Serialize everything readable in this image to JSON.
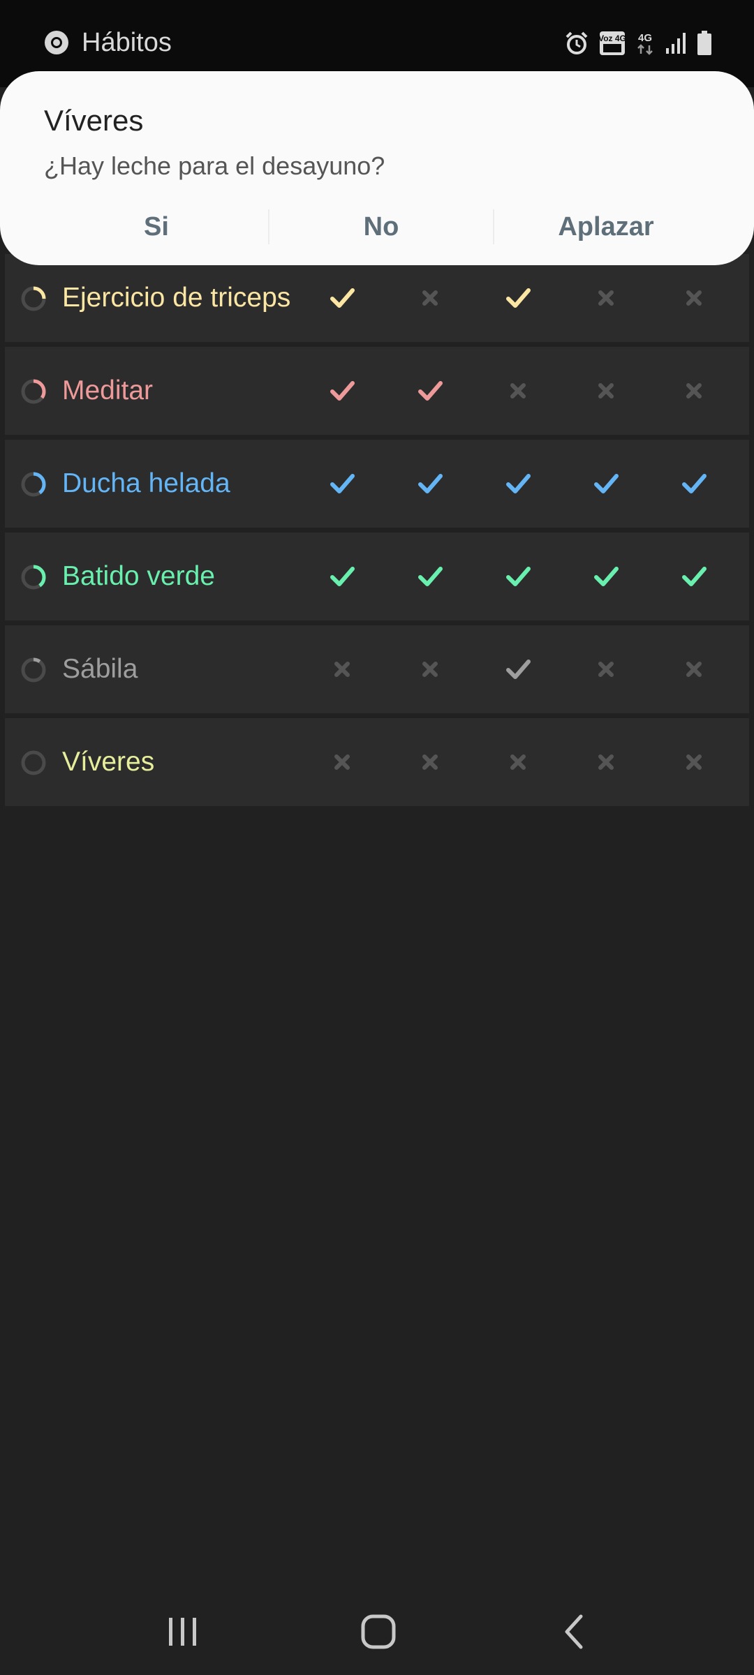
{
  "status_bar": {
    "app_name": "Hábitos",
    "icons": [
      "alarm-icon",
      "volte-icon",
      "network-4g-icon",
      "signal-icon",
      "battery-icon"
    ],
    "volte_label": "Voz 4G",
    "network_label": "4G"
  },
  "notification": {
    "title": "Víveres",
    "text": "¿Hay leche para el desayuno?",
    "actions": [
      "Si",
      "No",
      "Aplazar"
    ]
  },
  "colors": {
    "ejercicio": "#fce6a4",
    "meditar": "#ef9a9a",
    "ducha": "#64b5f6",
    "batido": "#69f0ae",
    "sabila": "#9e9e9e",
    "viveres": "#e6ee9c",
    "unchecked": "#555555"
  },
  "habits": [
    {
      "name": "Ejercicio de triceps",
      "color": "#fce6a4",
      "progress": 0.25,
      "days": [
        true,
        false,
        true,
        false,
        false
      ]
    },
    {
      "name": "Meditar",
      "color": "#ef9a9a",
      "progress": 0.35,
      "days": [
        true,
        true,
        false,
        false,
        false
      ]
    },
    {
      "name": "Ducha helada",
      "color": "#64b5f6",
      "progress": 0.4,
      "days": [
        true,
        true,
        true,
        true,
        true
      ]
    },
    {
      "name": "Batido verde",
      "color": "#69f0ae",
      "progress": 0.4,
      "days": [
        true,
        true,
        true,
        true,
        true
      ]
    },
    {
      "name": "Sábila",
      "color": "#9e9e9e",
      "progress": 0.1,
      "days": [
        false,
        false,
        true,
        false,
        false
      ]
    },
    {
      "name": "Víveres",
      "color": "#e6ee9c",
      "progress": 0,
      "days": [
        false,
        false,
        false,
        false,
        false
      ]
    }
  ],
  "nav_bar": {
    "buttons": [
      "recents-icon",
      "home-icon",
      "back-icon"
    ]
  }
}
